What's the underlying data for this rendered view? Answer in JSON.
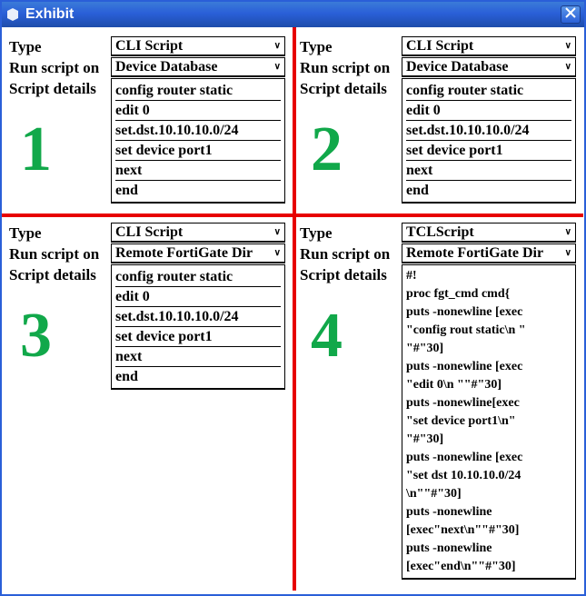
{
  "window": {
    "title": "Exhibit"
  },
  "panes": [
    {
      "num": "1",
      "type_label": "Type",
      "type_value": "CLI Script",
      "run_label": "Run script on",
      "run_value": "Device Database",
      "details_label": "Script details",
      "script_lines": [
        "config router static",
        "edit 0",
        "set.dst.10.10.10.0/24",
        "set device port1",
        "next",
        "end"
      ],
      "smallfont": false
    },
    {
      "num": "2",
      "type_label": "Type",
      "type_value": "CLI Script",
      "run_label": "Run script on",
      "run_value": "Device Database",
      "details_label": "Script details",
      "script_lines": [
        "config router static",
        "edit 0",
        "set.dst.10.10.10.0/24",
        "set device port1",
        "next",
        "end"
      ],
      "smallfont": false
    },
    {
      "num": "3",
      "type_label": "Type",
      "type_value": "CLI Script",
      "run_label": "Run script on",
      "run_value": "Remote FortiGate Dir",
      "details_label": "Script details",
      "script_lines": [
        "config router static",
        "edit 0",
        "set.dst.10.10.10.0/24",
        "set device port1",
        "next",
        "end"
      ],
      "smallfont": false
    },
    {
      "num": "4",
      "type_label": "Type",
      "type_value": "TCLScript",
      "run_label": "Run script on",
      "run_value": "Remote FortiGate Dir",
      "details_label": "Script details",
      "script_lines": [
        "#!",
        "proc fgt_cmd cmd{",
        "puts -nonewline [exec",
        "\"config rout static\\n \"",
        "\"#\"30]",
        "puts -nonewline [exec",
        "\"edit 0\\n \"\"#\"30]",
        "puts -nonewline[exec",
        "\"set device port1\\n\"",
        "\"#\"30]",
        "puts -nonewline [exec",
        "\"set dst 10.10.10.0/24",
        "\\n\"\"#\"30]",
        "puts -nonewline",
        "[exec\"next\\n\"\"#\"30]",
        "puts -nonewline",
        "[exec\"end\\n\"\"#\"30]"
      ],
      "smallfont": true
    }
  ]
}
